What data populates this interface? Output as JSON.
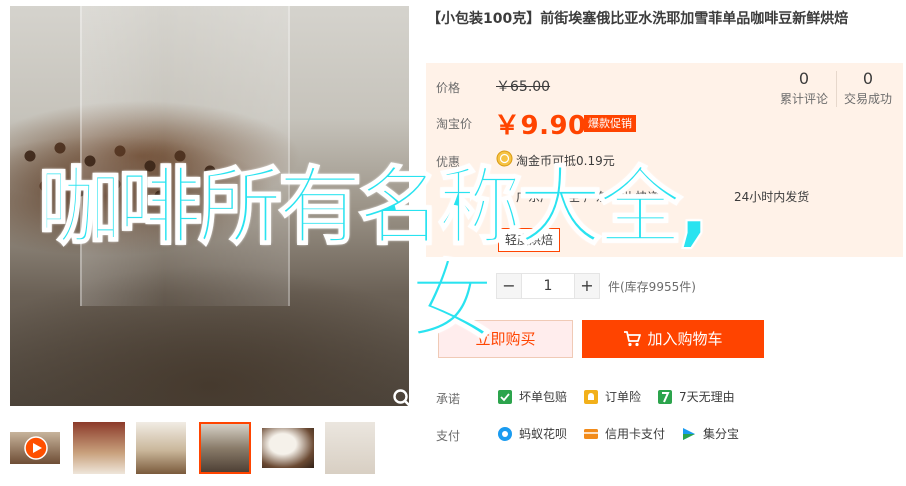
{
  "product": {
    "title": "【小包装100克】前街埃塞俄比亚水洗耶加雪菲单品咖啡豆新鲜烘焙"
  },
  "price": {
    "label": "价格",
    "original": "￥65.00",
    "taobao_label": "淘宝价",
    "current": "￥9.90",
    "tag": "爆款促销",
    "promo_label": "优惠",
    "promo_icon": "gold-coin-icon",
    "promo_text": "淘金币可抵0.19元"
  },
  "stats": {
    "reviews_count": "0",
    "reviews_label": "累计评论",
    "trades_count": "0",
    "trades_label": "交易成功"
  },
  "shipping": {
    "text": "广东广州 至 广东广州 快递:",
    "right": "24小时内发货"
  },
  "flavor": {
    "option": "轻度烘焙"
  },
  "quantity": {
    "minus": "−",
    "value": "1",
    "plus": "+",
    "stock": "件(库存9955件)"
  },
  "buttons": {
    "buy_now": "立即购买",
    "add_to_cart": "加入购物车"
  },
  "promises": {
    "label": "承诺",
    "items": [
      {
        "text": "坏单包赔",
        "icon": "shield-icon",
        "color": "#2ca44c"
      },
      {
        "text": "订单险",
        "icon": "bell-icon",
        "color": "#f2b01a"
      },
      {
        "text": "7天无理由",
        "icon": "seven-day-icon",
        "color": "#2ca44c"
      }
    ]
  },
  "payments": {
    "label": "支付",
    "items": [
      {
        "text": "蚂蚁花呗",
        "icon": "huabei-icon",
        "color": "#1a9bf0"
      },
      {
        "text": "信用卡支付",
        "icon": "credit-card-icon",
        "color": "#f28b1a"
      },
      {
        "text": "集分宝",
        "icon": "jifenbao-icon",
        "color": "#1a9bf0"
      }
    ]
  },
  "overlay": {
    "line1": "咖啡所有名称大全,",
    "line2": "女"
  },
  "colors": {
    "accent": "#ff4400",
    "price_bg": "#fff2e8",
    "overlay_text": "#29e3f0"
  }
}
